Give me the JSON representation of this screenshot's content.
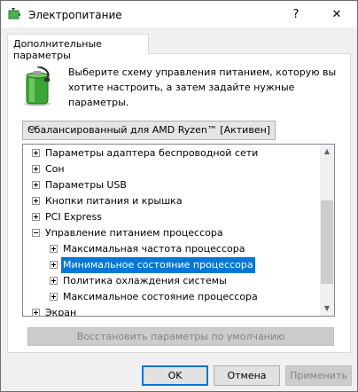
{
  "window": {
    "title": "Электропитание",
    "minimize_glyph": "?",
    "close_glyph": "✕"
  },
  "tab": {
    "label": "Дополнительные параметры"
  },
  "description": "Выберите схему управления питанием, которую вы хотите настроить, а затем задайте нужные параметры.",
  "plan_select": {
    "value": "Сбалансированный для AMD Ryzen™ [Активен]"
  },
  "tree": {
    "items": [
      {
        "label": "Параметры адаптера беспроводной сети",
        "expanded": false,
        "level": 0
      },
      {
        "label": "Сон",
        "expanded": false,
        "level": 0
      },
      {
        "label": "Параметры USB",
        "expanded": false,
        "level": 0
      },
      {
        "label": "Кнопки питания и крышка",
        "expanded": false,
        "level": 0
      },
      {
        "label": "PCI Express",
        "expanded": false,
        "level": 0
      },
      {
        "label": "Управление питанием процессора",
        "expanded": true,
        "level": 0
      },
      {
        "label": "Максимальная частота процессора",
        "expanded": false,
        "level": 1
      },
      {
        "label": "Минимальное состояние процессора",
        "expanded": false,
        "level": 1,
        "selected": true
      },
      {
        "label": "Политика охлаждения системы",
        "expanded": false,
        "level": 1
      },
      {
        "label": "Максимальное состояние процессора",
        "expanded": false,
        "level": 1
      },
      {
        "label": "Экран",
        "expanded": false,
        "level": 0
      }
    ]
  },
  "restore_button": {
    "label": "Восстановить параметры по умолчанию"
  },
  "buttons": {
    "ok": "OK",
    "cancel": "Отмена",
    "apply": "Применить"
  },
  "colors": {
    "selection": "#0078d7",
    "accent_green": "#3aa635"
  }
}
